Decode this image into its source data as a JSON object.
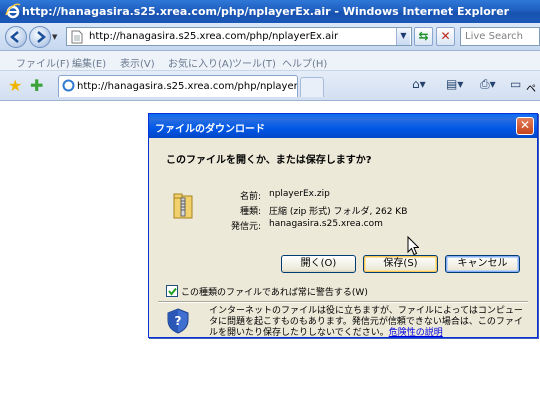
{
  "browser": {
    "window_title": "http://hanagasira.s25.xrea.com/php/nplayerEx.air - Windows Internet Explorer",
    "address_url": "http://hanagasira.s25.xrea.com/php/nplayerEx.air",
    "search_placeholder": "Live Search",
    "menu": [
      "ファイル(F)",
      "編集(E)",
      "表示(V)",
      "お気に入り(A)",
      "ツール(T)",
      "ヘルプ(H)"
    ],
    "tab_title": "http://hanagasira.s25.xrea.com/php/nplayerEx.air",
    "toolbar_page_label": "ペ"
  },
  "dialog": {
    "title": "ファイルのダウンロード",
    "question": "このファイルを開くか、または保存しますか?",
    "fields": [
      {
        "label": "名前:",
        "value": "nplayerEx.zip"
      },
      {
        "label": "種類:",
        "value": "圧縮 (zip 形式) フォルダ, 262 KB"
      },
      {
        "label": "発信元:",
        "value": "hanagasira.s25.xrea.com"
      }
    ],
    "buttons": {
      "open": "開く(O)",
      "save": "保存(S)",
      "cancel": "キャンセル"
    },
    "checkbox_label": "この種類のファイルであれば常に警告する(W)",
    "checkbox_checked": true,
    "warning_text": "インターネットのファイルは役に立ちますが、ファイルによってはコンピュータに問題を起こすものもあります。発信元が信頼できない場合は、このファイルを開いたり保存したりしないでください。",
    "warning_link": "危険性の説明"
  },
  "colors": {
    "titlebar": "#1f5fbf",
    "dialog_bg": "#ece9d8",
    "link": "#0000e0"
  }
}
